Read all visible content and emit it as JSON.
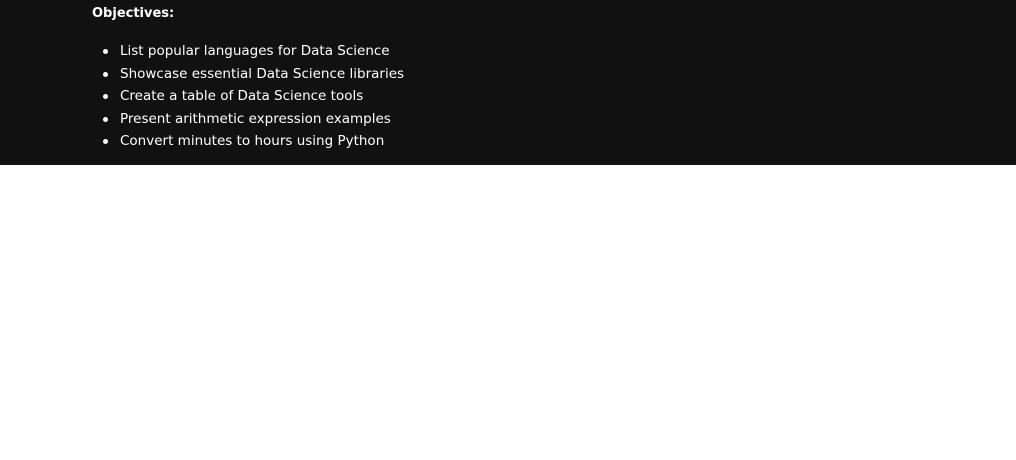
{
  "objectives": {
    "heading": "Objectives:",
    "items": [
      "List popular languages for Data Science",
      "Showcase essential Data Science libraries",
      "Create a table of Data Science tools",
      "Present arithmetic expression examples",
      "Convert minutes to hours using Python"
    ]
  }
}
